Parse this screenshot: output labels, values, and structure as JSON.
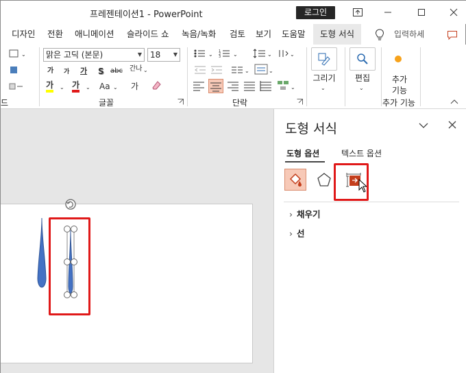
{
  "window": {
    "title": "프레젠테이션1  -  PowerPoint",
    "login_label": "로그인"
  },
  "tabs": [
    {
      "label": "디자인"
    },
    {
      "label": "전환"
    },
    {
      "label": "애니메이션"
    },
    {
      "label": "슬라이드 쇼"
    },
    {
      "label": "녹음/녹화"
    },
    {
      "label": "검토"
    },
    {
      "label": "보기"
    },
    {
      "label": "도움말"
    },
    {
      "label": "도형 서식"
    }
  ],
  "tell_me": {
    "placeholder": "입력하세"
  },
  "ribbon": {
    "font_name": "맑은 고딕 (본문)",
    "font_size": "18",
    "font_group_label": "글꼴",
    "paragraph_group_label": "단락",
    "left_group_label_partial": "드",
    "draw_label": "그리기",
    "edit_label": "편집",
    "addin_label_1": "추가",
    "addin_label_2": "기능",
    "addin_group_label": "추가 기능",
    "font_buttons": {
      "grow": "가",
      "shrink": "가",
      "clear": "가",
      "shadow": "S",
      "strike": "abc",
      "spacing": "간나",
      "highlight": "가",
      "font_color": "가",
      "case": "Aa",
      "hanja": "가",
      "kr": "가"
    }
  },
  "pane": {
    "title": "도형 서식",
    "tab_shape_options": "도형 옵션",
    "tab_text_options": "텍스트 옵션",
    "section_fill": "채우기",
    "section_line": "선"
  },
  "colors": {
    "accent": "#c43e1c",
    "highlight_box": "#e01919",
    "shape_fill": "#4472c4",
    "active_icon_bg": "#f7c9b7"
  }
}
